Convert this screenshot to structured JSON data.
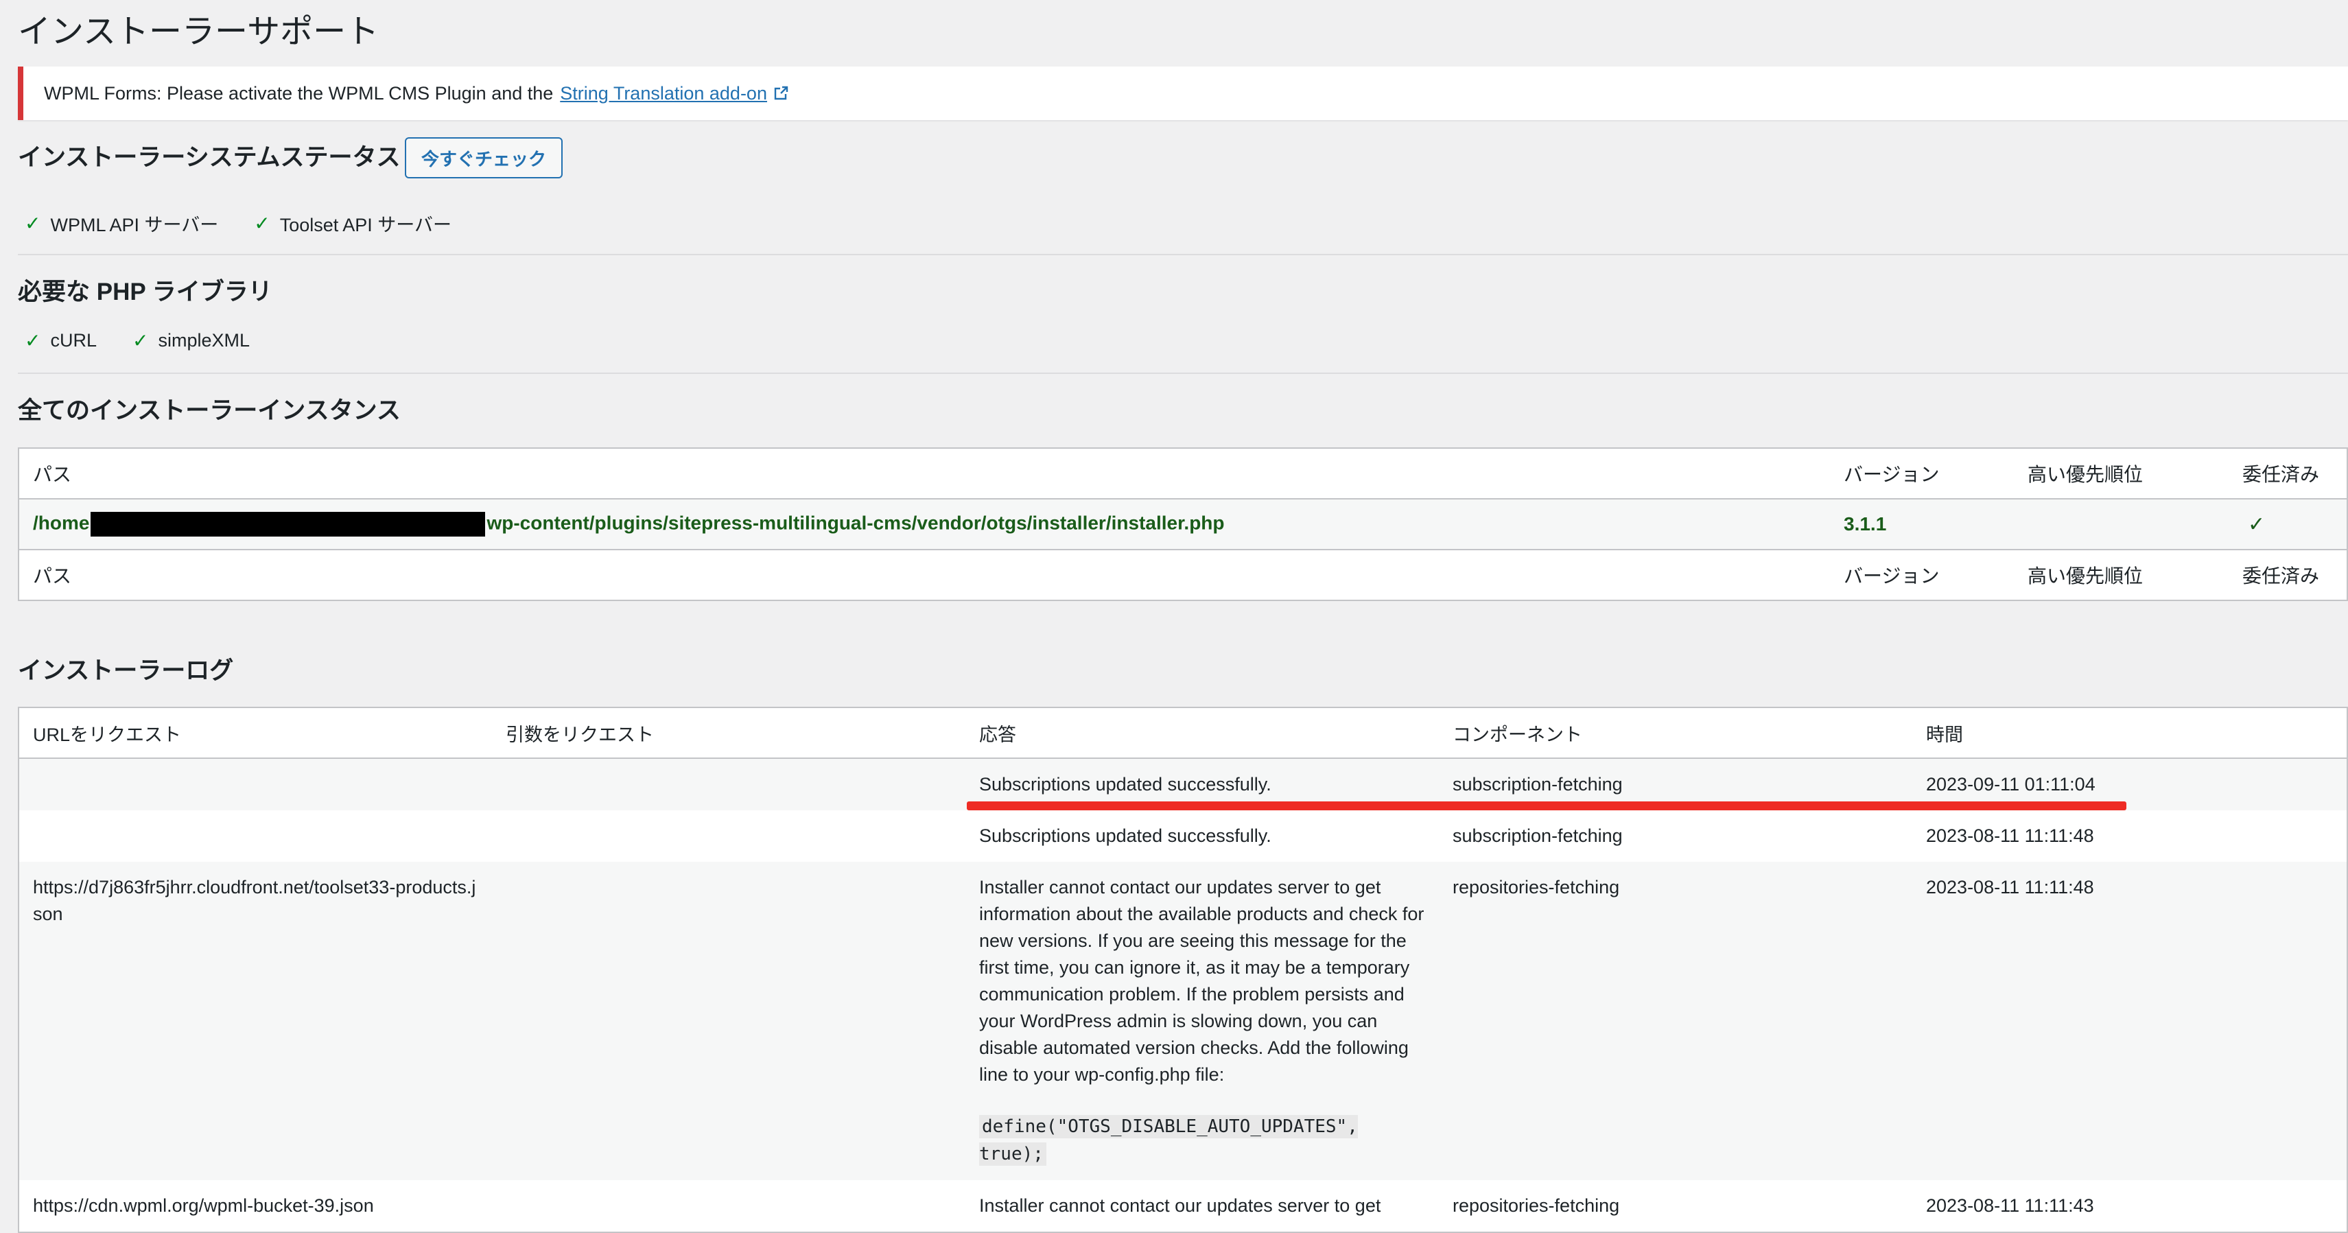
{
  "page": {
    "title": "インストーラーサポート"
  },
  "notice": {
    "text": "WPML Forms: Please activate the WPML CMS Plugin and the",
    "link": "String Translation add-on",
    "link_icon": "external-link-icon"
  },
  "system_status": {
    "heading": "インストーラーシステムステータス",
    "check_button": "今すぐチェック",
    "items": [
      "WPML API サーバー",
      "Toolset API サーバー"
    ]
  },
  "php_libraries": {
    "heading": "必要な PHP ライブラリ",
    "items": [
      "cURL",
      "simpleXML"
    ]
  },
  "instances": {
    "heading": "全てのインストーラーインスタンス",
    "columns": [
      "パス",
      "バージョン",
      "高い優先順位",
      "委任済み"
    ],
    "rows": [
      {
        "path_prefix": "/home",
        "path_suffix": "wp-content/plugins/sitepress-multilingual-cms/vendor/otgs/installer/installer.php",
        "version": "3.1.1",
        "high_priority": "",
        "delegated_icon": "checkmark-icon"
      }
    ]
  },
  "log": {
    "heading": "インストーラーログ",
    "columns": [
      "URLをリクエスト",
      "引数をリクエスト",
      "応答",
      "コンポーネント",
      "時間"
    ],
    "rows": [
      {
        "url": "",
        "args": "",
        "response": "Subscriptions updated successfully.",
        "component": "subscription-fetching",
        "time": "2023-09-11 01:11:04"
      },
      {
        "url": "",
        "args": "",
        "response": "Subscriptions updated successfully.",
        "component": "subscription-fetching",
        "time": "2023-08-11 11:11:48"
      },
      {
        "url": "https://d7j863fr5jhrr.cloudfront.net/toolset33-products.json",
        "args": "",
        "response": "Installer cannot contact our updates server to get information about the available products and check for new versions. If you are seeing this message for the first time, you can ignore it, as it may be a temporary communication problem. If the problem persists and your WordPress admin is slowing down, you can disable automated version checks. Add the following line to your wp-config.php file:",
        "code": "define(\"OTGS_DISABLE_AUTO_UPDATES\", true);",
        "component": "repositories-fetching",
        "time": "2023-08-11 11:11:48"
      },
      {
        "url": "https://cdn.wpml.org/wpml-bucket-39.json",
        "args": "",
        "response": "Installer cannot contact our updates server to get",
        "component": "repositories-fetching",
        "time": "2023-08-11 11:11:43"
      }
    ]
  },
  "colors": {
    "accent": "#2271b1",
    "error": "#d63638",
    "success": "#008a20",
    "annotation": "#ee2b24"
  }
}
